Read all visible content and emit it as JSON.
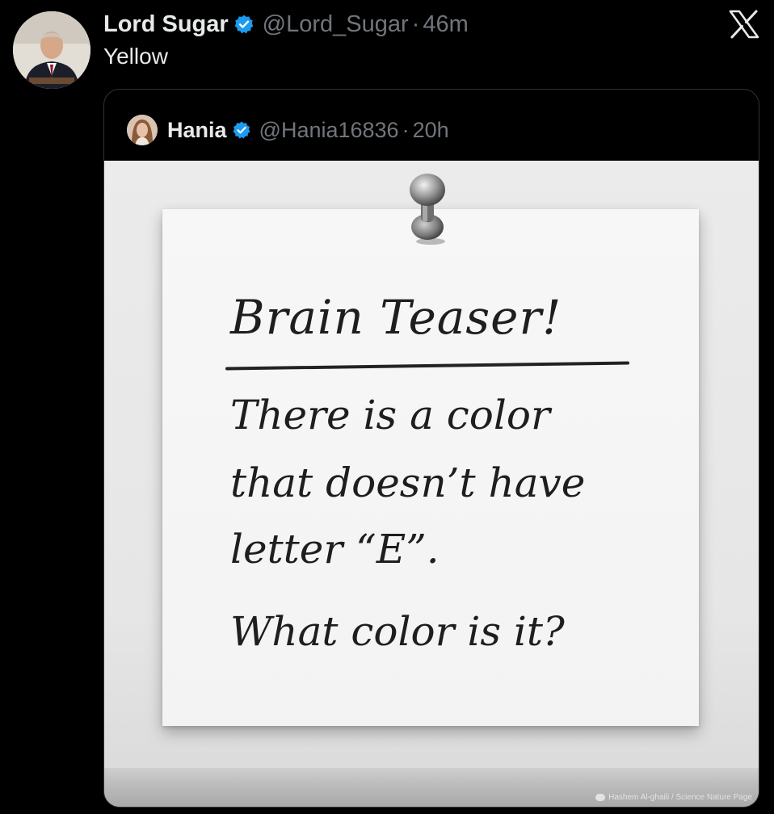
{
  "tweet": {
    "author_name": "Lord Sugar",
    "handle": "@Lord_Sugar",
    "separator": "·",
    "time": "46m",
    "text": "Yellow"
  },
  "quoted_tweet": {
    "author_name": "Hania",
    "handle": "@Hania16836",
    "separator": "·",
    "time": "20h",
    "image": {
      "note_title": "Brain Teaser!",
      "note_lines": [
        "There is a color",
        "that doesn’t have",
        "letter “E”.",
        "What color is it?"
      ],
      "photo_credit": "Hashem Al-ghaili / Science Nature Page"
    }
  },
  "icons": {
    "verified": "verified-badge-icon",
    "platform": "x-logo-icon"
  },
  "colors": {
    "background": "#000000",
    "primary_text": "#e7e9ea",
    "secondary_text": "#71767b",
    "verified_blue": "#1d9bf0",
    "border": "#2f3336"
  }
}
